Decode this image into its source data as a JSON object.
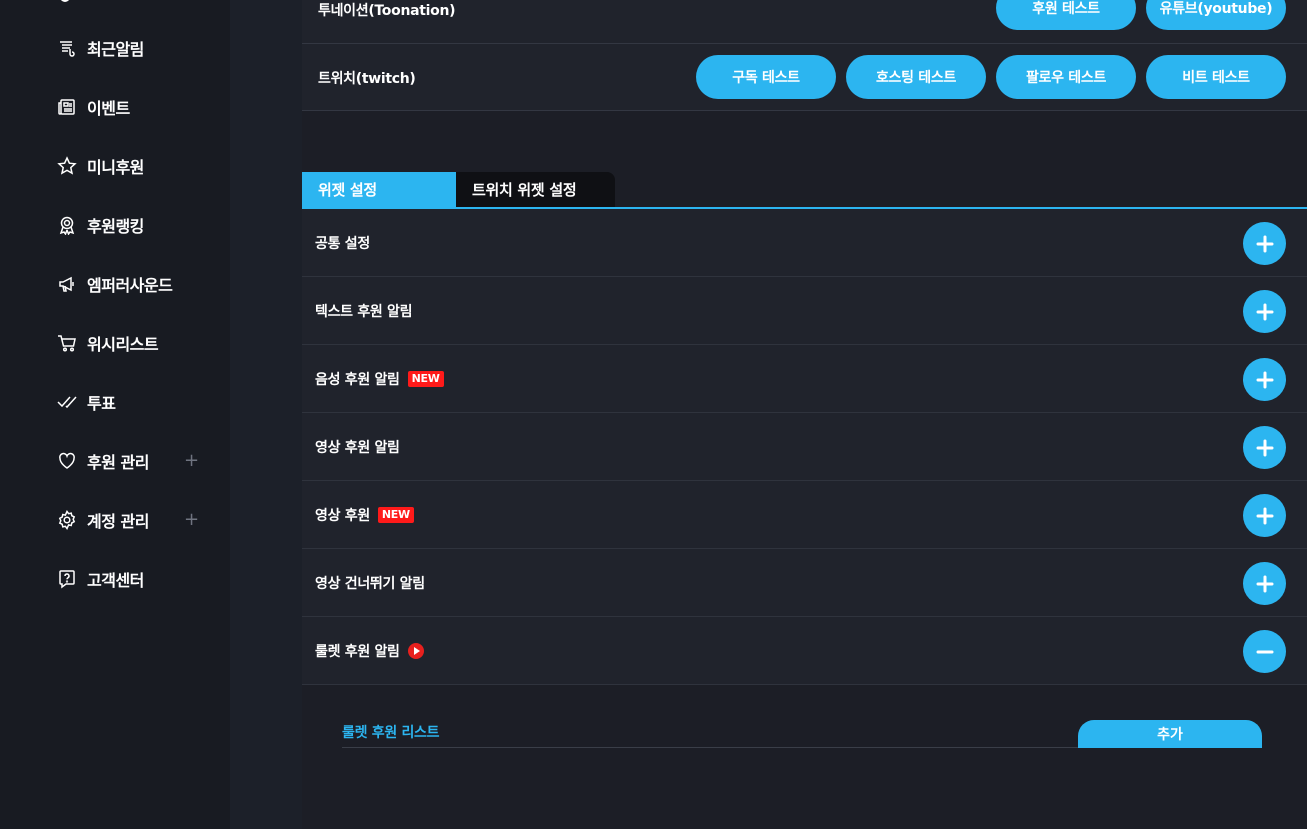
{
  "sidebar": {
    "items": [
      {
        "label": "최근알림",
        "icon": "notification-list-icon"
      },
      {
        "label": "이벤트",
        "icon": "newspaper-icon"
      },
      {
        "label": "미니후원",
        "icon": "star-icon"
      },
      {
        "label": "후원랭킹",
        "icon": "award-ribbon-icon"
      },
      {
        "label": "엠퍼러사운드",
        "icon": "megaphone-icon"
      },
      {
        "label": "위시리스트",
        "icon": "cart-icon"
      },
      {
        "label": "투표",
        "icon": "double-check-icon"
      },
      {
        "label": "후원 관리",
        "icon": "heart-icon",
        "expand": "+"
      },
      {
        "label": "계정 관리",
        "icon": "gear-icon",
        "expand": "+"
      },
      {
        "label": "고객센터",
        "icon": "help-bubble-icon"
      }
    ]
  },
  "test_rows": {
    "toonation": {
      "label": "투네이션(Toonation)",
      "buttons": [
        "후원 테스트",
        "유튜브(youtube)"
      ]
    },
    "twitch": {
      "label": "트위치(twitch)",
      "buttons": [
        "구독 테스트",
        "호스팅 테스트",
        "팔로우 테스트",
        "비트 테스트"
      ]
    }
  },
  "tabs": {
    "widget_settings": "위젯 설정",
    "twitch_widget_settings": "트위치 위젯 설정",
    "active": "widget_settings"
  },
  "accordion": [
    {
      "label": "공통 설정",
      "expanded": false
    },
    {
      "label": "텍스트 후원 알림",
      "expanded": false
    },
    {
      "label": "음성 후원 알림",
      "badge": "NEW",
      "expanded": false
    },
    {
      "label": "영상 후원 알림",
      "expanded": false
    },
    {
      "label": "영상 후원",
      "badge": "NEW",
      "expanded": false
    },
    {
      "label": "영상 건너뛰기 알림",
      "expanded": false
    },
    {
      "label": "룰렛 후원 알림",
      "icon": "play-icon",
      "expanded": true
    }
  ],
  "roulette": {
    "list_title": "룰렛 후원 리스트",
    "add_button": "추가"
  },
  "colors": {
    "accent": "#2cb5f0",
    "badge_red": "#ff1a1a",
    "sidebar_bg": "#181b22",
    "row_bg": "#20232c"
  }
}
